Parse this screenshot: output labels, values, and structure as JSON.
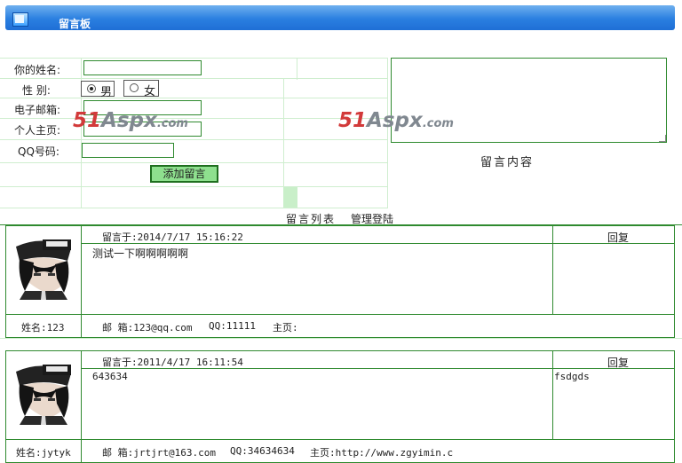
{
  "header": {
    "title": "留言板"
  },
  "form": {
    "name_label": "你的姓名:",
    "gender_label": "性 别:",
    "gender_male": "男",
    "gender_female": "女",
    "email_label": "电子邮箱:",
    "homepage_label": "个人主页:",
    "qq_label": "QQ号码:",
    "submit_label": "添加留言",
    "content_label": "留言内容"
  },
  "watermark": {
    "num": "51",
    "aspx": "Aspx",
    "com": ".com"
  },
  "nav": {
    "list_label": "留言列表",
    "admin_label": "管理登陆"
  },
  "messages": [
    {
      "time": "留言于:2014/7/17 15:16:22",
      "reply_label": "回复",
      "content": "测试一下啊啊啊啊啊",
      "reply_text": "",
      "name": "姓名:123",
      "email": "邮 箱:123@qq.com",
      "qq": "QQ:11111",
      "homepage": "主页:"
    },
    {
      "time": "留言于:2011/4/17 16:11:54",
      "reply_label": "回复",
      "content": "643634",
      "reply_text": "fsdgds",
      "name": "姓名:jytyk",
      "email": "邮 箱:jrtjrt@163.com",
      "qq": "QQ:34634634",
      "homepage": "主页:http://www.zgyimin.c"
    }
  ]
}
